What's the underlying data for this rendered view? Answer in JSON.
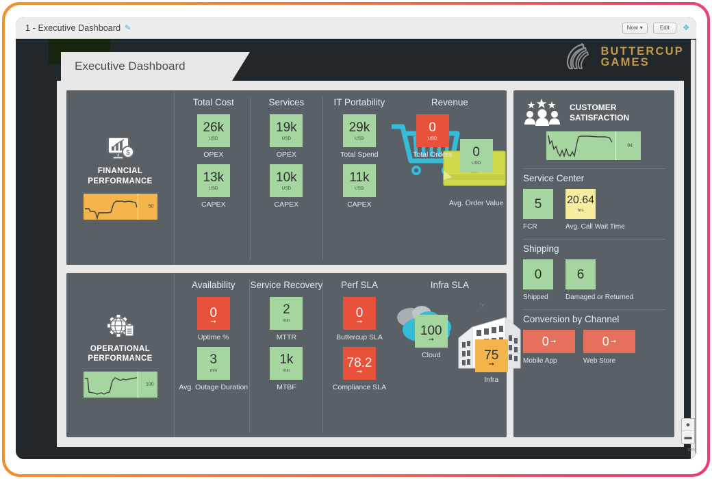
{
  "topbar": {
    "title": "1 - Executive Dashboard",
    "edit_pencil_icon": "pencil-icon",
    "time_range_label": "Now",
    "time_range_caret": "▾",
    "edit_label": "Edit",
    "fullscreen_icon": "expand-icon"
  },
  "header": {
    "tab_title": "Executive Dashboard",
    "brand_line1": "BUTTERCUP",
    "brand_line2": "GAMES",
    "brand_icon": "horse-head-icon",
    "brand_color": "#c29b49"
  },
  "colors": {
    "panel": "#596167",
    "canvas": "#22272b",
    "page": "#e8e8e8",
    "green": "#a5d6a0",
    "red": "#e8513a",
    "salmon": "#e5705c",
    "orange": "#f3b44c",
    "yellow": "#f6eda0",
    "cyan": "#35bcd8"
  },
  "financial": {
    "icon": "monitor-chart-dollar-icon",
    "title_line1": "FINANCIAL",
    "title_line2": "PERFORMANCE",
    "spark_value": "50",
    "spark_color": "#f3b44c",
    "columns": [
      {
        "title": "Total Cost",
        "tiles": [
          {
            "value": "26k",
            "unit": "USD",
            "label": "OPEX",
            "color": "green"
          },
          {
            "value": "13k",
            "unit": "USD",
            "label": "CAPEX",
            "color": "green"
          }
        ]
      },
      {
        "title": "Services",
        "tiles": [
          {
            "value": "19k",
            "unit": "USD",
            "label": "OPEX",
            "color": "green"
          },
          {
            "value": "10k",
            "unit": "USD",
            "label": "CAPEX",
            "color": "green"
          }
        ]
      },
      {
        "title": "IT Portability",
        "tiles": [
          {
            "value": "29k",
            "unit": "USD",
            "label": "Total Spend",
            "color": "green"
          },
          {
            "value": "11k",
            "unit": "USD",
            "label": "CAPEX",
            "color": "green"
          }
        ]
      }
    ],
    "revenue": {
      "title": "Revenue",
      "cart_icon": "shopping-cart-icon",
      "money_icon": "cash-stack-icon",
      "total_orders": {
        "value": "0",
        "unit": "USD",
        "label": "Total Orders",
        "color": "red"
      },
      "avg_order_value": {
        "value": "0",
        "unit": "USD",
        "label": "Avg. Order Value",
        "color": "green"
      }
    }
  },
  "operational": {
    "icon": "gear-globe-clipboard-icon",
    "title_line1": "OPERATIONAL",
    "title_line2": "PERFORMANCE",
    "spark_value": "100",
    "spark_color": "#a5d6a0",
    "columns": [
      {
        "title": "Availability",
        "tiles": [
          {
            "value": "0",
            "unit": "",
            "label": "Uptime %",
            "color": "red",
            "trend": "down"
          },
          {
            "value": "3",
            "unit": "min",
            "label": "Avg. Outage Duration",
            "color": "green"
          }
        ]
      },
      {
        "title": "Service Recovery",
        "tiles": [
          {
            "value": "2",
            "unit": "min",
            "label": "MTTR",
            "color": "green"
          },
          {
            "value": "1k",
            "unit": "min",
            "label": "MTBF",
            "color": "green"
          }
        ]
      },
      {
        "title": "Perf SLA",
        "tiles": [
          {
            "value": "0",
            "unit": "",
            "label": "Buttercup SLA",
            "color": "red",
            "trend": "down"
          },
          {
            "value": "78.2",
            "unit": "",
            "label": "Compliance SLA",
            "color": "red",
            "trend": "down"
          }
        ]
      }
    ],
    "infra": {
      "title": "Infra SLA",
      "cloud_icon": "cloud-icon",
      "building_icon": "office-building-icon",
      "cloud": {
        "value": "100",
        "label": "Cloud",
        "color": "green",
        "trend": "down"
      },
      "infra": {
        "value": "75",
        "label": "Infra",
        "color": "orange",
        "trend": "down"
      }
    }
  },
  "sidebar": {
    "customer_satisfaction": {
      "icon": "people-stars-icon",
      "title_line1": "CUSTOMER",
      "title_line2": "SATISFACTION",
      "spark_value": "94",
      "spark_color": "#a5d6a0"
    },
    "service_center": {
      "title": "Service Center",
      "tiles": [
        {
          "value": "5",
          "unit": "",
          "label": "FCR",
          "color": "green"
        },
        {
          "value": "20.64",
          "unit": "hrs",
          "label": "Avg. Call Wait Time",
          "color": "yellow"
        }
      ]
    },
    "shipping": {
      "title": "Shipping",
      "tiles": [
        {
          "value": "0",
          "unit": "",
          "label": "Shipped",
          "color": "green"
        },
        {
          "value": "6",
          "unit": "",
          "label": "Damaged or Returned",
          "color": "green"
        }
      ]
    },
    "conversion": {
      "title": "Conversion by Channel",
      "tiles": [
        {
          "value": "0",
          "unit": "",
          "label": "Mobile App",
          "color": "salmon",
          "trend": "down"
        },
        {
          "value": "0",
          "unit": "",
          "label": "Web Store",
          "color": "salmon",
          "trend": "down"
        }
      ]
    }
  },
  "zoom_control": {
    "zoom_in_icon": "plus-icon",
    "zoom_out_icon": "minus-icon",
    "label": "100%"
  }
}
